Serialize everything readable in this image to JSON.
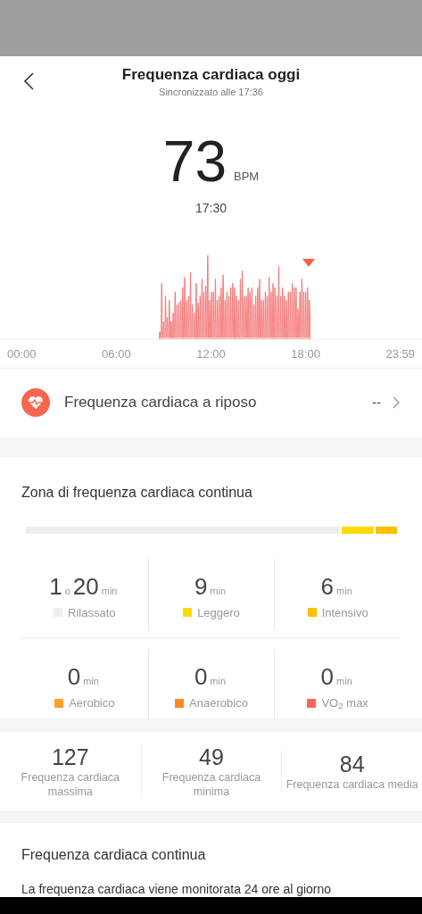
{
  "header": {
    "title": "Frequenza cardiaca oggi",
    "subtitle": "Sincronizzato alle 17:36"
  },
  "current": {
    "value": "73",
    "unit": "BPM",
    "time": "17:30"
  },
  "chart": {
    "axis_labels": [
      "00:00",
      "06:00",
      "12:00",
      "18:00",
      "23:59"
    ]
  },
  "resting": {
    "label": "Frequenza cardiaca a riposo",
    "value": "--"
  },
  "zones": {
    "title": "Zona di frequenza cardiaca continua",
    "items": [
      {
        "parts": [
          {
            "number": "1",
            "unit": "o"
          },
          {
            "number": "20",
            "unit": "min"
          }
        ],
        "label": "Rilassato",
        "color": "#eceef0"
      },
      {
        "parts": [
          {
            "number": "9",
            "unit": "min"
          }
        ],
        "label": "Leggero",
        "color": "#ffd900"
      },
      {
        "parts": [
          {
            "number": "6",
            "unit": "min"
          }
        ],
        "label": "Intensivo",
        "color": "#ffbe00"
      },
      {
        "parts": [
          {
            "number": "0",
            "unit": "min"
          }
        ],
        "label": "Aerobico",
        "color": "#ff9f2e"
      },
      {
        "parts": [
          {
            "number": "0",
            "unit": "min"
          }
        ],
        "label": "Anaerobico",
        "color": "#ff8a1c"
      },
      {
        "parts": [
          {
            "number": "0",
            "unit": "min"
          }
        ],
        "label": "VO$_{2}$ max",
        "color": "#ff6459"
      }
    ]
  },
  "stats": [
    {
      "value": "127",
      "label": "Frequenza cardiaca massima"
    },
    {
      "value": "49",
      "label": "Frequenza cardiaca minima"
    },
    {
      "value": "84",
      "label": "Frequenza cardiaca media"
    }
  ],
  "continuous": {
    "title": "Frequenza cardiaca continua",
    "text": "La frequenza cardiaca viene monitorata 24 ore al giorno"
  }
}
